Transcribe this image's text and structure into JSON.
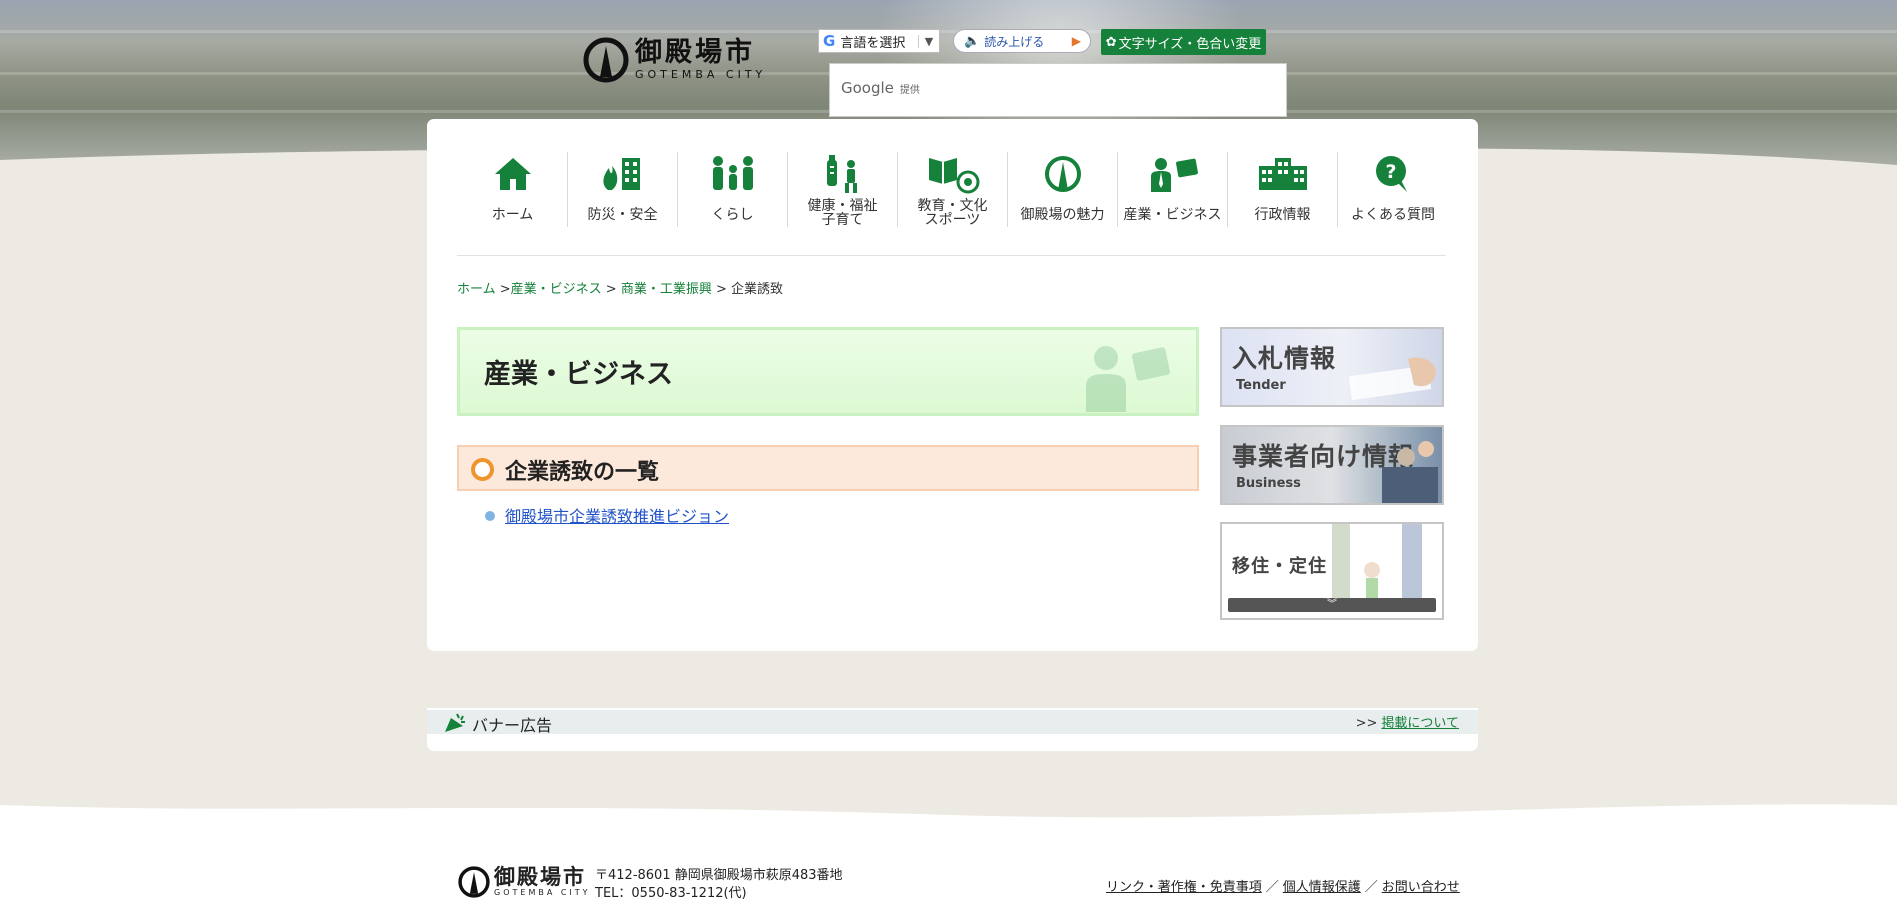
{
  "site": {
    "name_jp": "御殿場市",
    "name_en": "GOTEMBA CITY"
  },
  "tools": {
    "translate_label": "言語を選択",
    "translate_arrow": "▼",
    "read_aloud_label": "読み上げる",
    "font_color_label": "文字サイズ・色合い変更",
    "search_provider": "Google",
    "search_provider_suffix": "提供"
  },
  "nav": {
    "items": [
      {
        "label": "ホーム",
        "icon": "home-icon"
      },
      {
        "label": "防災・安全",
        "icon": "disaster-icon"
      },
      {
        "label": "くらし",
        "icon": "family-icon"
      },
      {
        "label": "健康・福祉 子育て",
        "icon": "health-icon"
      },
      {
        "label": "教育・文化 スポーツ",
        "icon": "education-icon"
      },
      {
        "label": "御殿場の魅力",
        "icon": "attraction-icon"
      },
      {
        "label": "産業・ビジネス",
        "icon": "business-icon"
      },
      {
        "label": "行政情報",
        "icon": "government-icon"
      },
      {
        "label": "よくある質問",
        "icon": "faq-icon"
      }
    ]
  },
  "breadcrumb": {
    "home": "ホーム",
    "sep1": " >",
    "level1": "産業・ビジネス",
    "sep2": " > ",
    "level2": "商業・工業振興",
    "sep3": " > ",
    "current": "企業誘致"
  },
  "page": {
    "category_title": "産業・ビジネス",
    "section_title": "企業誘致の一覧",
    "links": [
      "御殿場市企業誘致推進ビジョン"
    ]
  },
  "side_banners": [
    {
      "title": "入札情報",
      "subtitle": "Tender"
    },
    {
      "title": "事業者向け情報",
      "subtitle": "Business"
    },
    {
      "title": "移住・定住",
      "subtitle": ""
    }
  ],
  "ad_banner": {
    "title": "バナー広告",
    "more_label": "掲載について",
    "more_prefix": ">>"
  },
  "footer": {
    "postal_address": "〒412-8601 静岡県御殿場市萩原483番地",
    "tel": "TEL：0550-83-1212(代)",
    "links": [
      "リンク・著作権・免責事項",
      "個人情報保護",
      "お問い合わせ"
    ],
    "sep": "／"
  },
  "colors": {
    "brand_green": "#16813a",
    "background": "#edeae3",
    "title_bg": "#dcf9d3",
    "section_bg": "#fde9dc",
    "section_ring": "#f0942d",
    "link_blue": "#2153c9"
  }
}
